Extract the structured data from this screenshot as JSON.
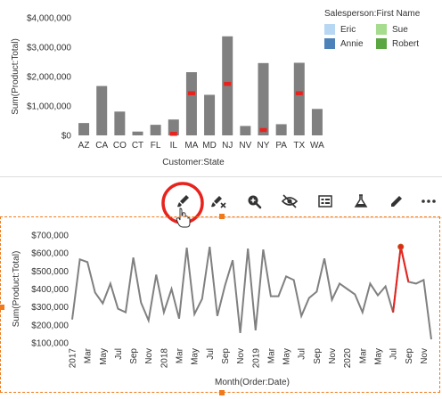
{
  "colors": {
    "bar": "#808080",
    "highlight": "#e8231e",
    "line": "#808080",
    "accent_orange": "#f07a1a",
    "callout_red": "#e8231e",
    "eric": "#b7d7f2",
    "sue": "#a6dc8e",
    "annie": "#4d82b9",
    "robert": "#5aa640"
  },
  "legend": {
    "title": "Salesperson:First Name",
    "items": [
      {
        "label": "Eric",
        "color": "#b7d7f2"
      },
      {
        "label": "Sue",
        "color": "#a6dc8e"
      },
      {
        "label": "Annie",
        "color": "#4d82b9"
      },
      {
        "label": "Robert",
        "color": "#5aa640"
      }
    ]
  },
  "toolbar": {
    "buttons": [
      {
        "name": "brush-icon",
        "highlighted": true
      },
      {
        "name": "clear-brush-icon",
        "highlighted": false
      },
      {
        "name": "zoom-in-icon",
        "highlighted": false
      },
      {
        "name": "hide-icon",
        "highlighted": false
      },
      {
        "name": "show-details-icon",
        "highlighted": false
      },
      {
        "name": "flask-icon",
        "highlighted": false
      },
      {
        "name": "edit-icon",
        "highlighted": false
      },
      {
        "name": "more-icon",
        "highlighted": false
      }
    ]
  },
  "chart_data": [
    {
      "type": "bar",
      "xlabel": "Customer:State",
      "ylabel": "Sum(Product:Total)",
      "ylim": [
        0,
        4000000
      ],
      "y_ticks": [
        "$0",
        "$1,000,000",
        "$2,000,000",
        "$3,000,000",
        "$4,000,000"
      ],
      "y_tick_values": [
        0,
        1000000,
        2000000,
        3000000,
        4000000
      ],
      "categories": [
        "AZ",
        "CA",
        "CO",
        "CT",
        "FL",
        "IL",
        "MA",
        "MD",
        "NJ",
        "NV",
        "NY",
        "PA",
        "TX",
        "WA"
      ],
      "values": [
        420000,
        1680000,
        810000,
        130000,
        360000,
        540000,
        2150000,
        1380000,
        3370000,
        320000,
        2460000,
        380000,
        2470000,
        900000
      ],
      "highlighted": [
        0,
        0,
        0,
        0,
        0,
        60000,
        1440000,
        0,
        1760000,
        0,
        190000,
        0,
        1440000,
        0
      ],
      "legend_position": "right"
    },
    {
      "type": "line",
      "xlabel": "Month(Order:Date)",
      "ylabel": "Sum(Product:Total)",
      "ylim": [
        100000,
        700000
      ],
      "y_ticks": [
        "$100,000",
        "$200,000",
        "$300,000",
        "$400,000",
        "$500,000",
        "$600,000",
        "$700,000"
      ],
      "y_tick_values": [
        100000,
        200000,
        300000,
        400000,
        500000,
        600000,
        700000
      ],
      "x_ticks": [
        "2017",
        "Mar",
        "May",
        "Jul",
        "Sep",
        "Nov",
        "2018",
        "Mar",
        "May",
        "Jul",
        "Sep",
        "Nov",
        "2019",
        "Mar",
        "May",
        "Jul",
        "Sep",
        "Nov",
        "2020",
        "Mar",
        "May",
        "Jul",
        "Sep",
        "Nov"
      ],
      "series": [
        {
          "values": [
            230000,
            565000,
            550000,
            380000,
            320000,
            430000,
            290000,
            270000,
            575000,
            325000,
            225000,
            480000,
            270000,
            400000,
            235000,
            630000,
            260000,
            345000,
            635000,
            250000,
            420000,
            560000,
            155000,
            625000,
            170000,
            620000,
            360000,
            360000,
            470000,
            450000,
            250000,
            350000,
            385000,
            570000,
            340000,
            430000,
            400000,
            370000,
            270000,
            430000,
            365000,
            415000,
            270000,
            635000,
            440000,
            430000,
            450000,
            120000
          ]
        }
      ],
      "highlight_segment": [
        42,
        44
      ]
    }
  ]
}
